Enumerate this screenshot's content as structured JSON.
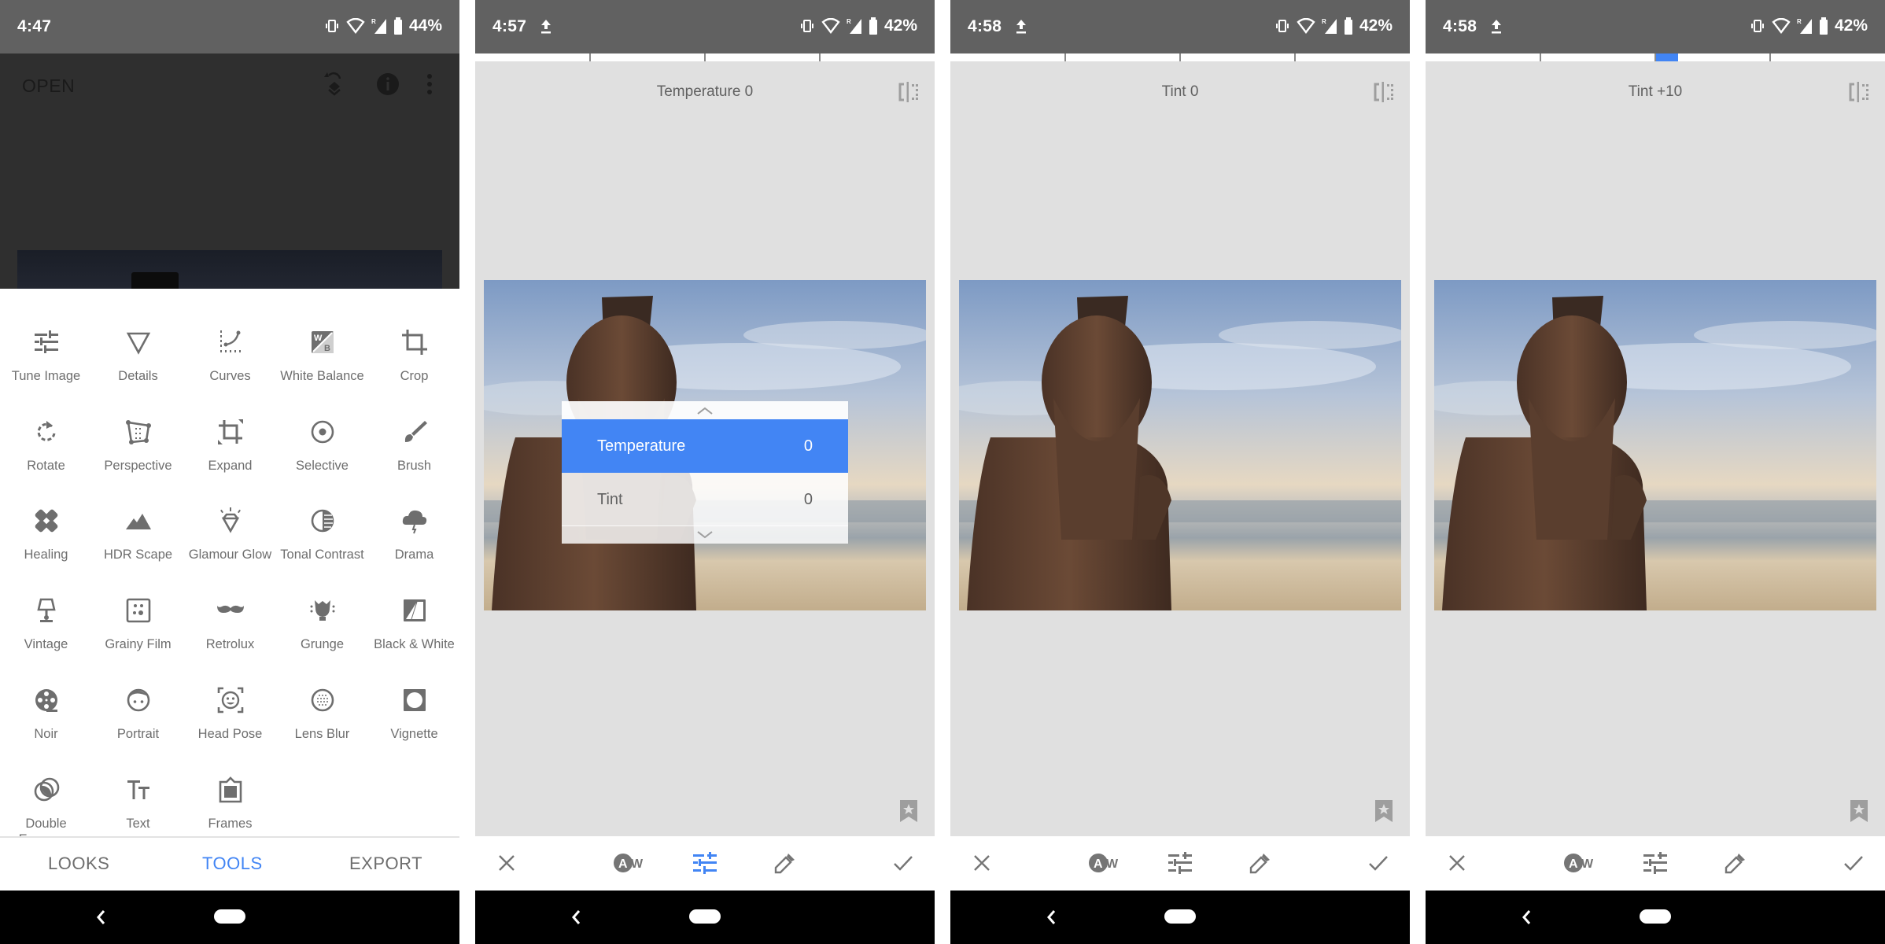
{
  "colors": {
    "accent": "#4285f4",
    "status_bar": "#616161",
    "editor_bg": "#e0e0e0",
    "icon_gray": "#6e6e6e"
  },
  "panels": [
    {
      "status": {
        "time": "4:47",
        "battery": "44%",
        "upload_icon": false
      },
      "header": {
        "open_label": "OPEN",
        "icons": [
          "undo-stack-icon",
          "info-icon",
          "more-vert-icon"
        ]
      },
      "tools": [
        {
          "label": "Tune Image",
          "icon": "tune-icon"
        },
        {
          "label": "Details",
          "icon": "details-triangle-icon"
        },
        {
          "label": "Curves",
          "icon": "curves-icon"
        },
        {
          "label": "White Balance",
          "icon": "white-balance-icon"
        },
        {
          "label": "Crop",
          "icon": "crop-icon"
        },
        {
          "label": "Rotate",
          "icon": "rotate-icon"
        },
        {
          "label": "Perspective",
          "icon": "perspective-icon"
        },
        {
          "label": "Expand",
          "icon": "expand-icon"
        },
        {
          "label": "Selective",
          "icon": "selective-icon"
        },
        {
          "label": "Brush",
          "icon": "brush-icon"
        },
        {
          "label": "Healing",
          "icon": "healing-icon"
        },
        {
          "label": "HDR Scape",
          "icon": "hdr-scape-icon"
        },
        {
          "label": "Glamour Glow",
          "icon": "glamour-glow-icon"
        },
        {
          "label": "Tonal Contrast",
          "icon": "tonal-contrast-icon"
        },
        {
          "label": "Drama",
          "icon": "drama-icon"
        },
        {
          "label": "Vintage",
          "icon": "vintage-lamp-icon"
        },
        {
          "label": "Grainy Film",
          "icon": "grainy-film-icon"
        },
        {
          "label": "Retrolux",
          "icon": "retrolux-mustache-icon"
        },
        {
          "label": "Grunge",
          "icon": "grunge-icon"
        },
        {
          "label": "Black & White",
          "icon": "black-white-icon"
        },
        {
          "label": "Noir",
          "icon": "noir-reel-icon"
        },
        {
          "label": "Portrait",
          "icon": "portrait-face-icon"
        },
        {
          "label": "Head Pose",
          "icon": "head-pose-icon"
        },
        {
          "label": "Lens Blur",
          "icon": "lens-blur-icon"
        },
        {
          "label": "Vignette",
          "icon": "vignette-icon"
        },
        {
          "label": "Double Exposure",
          "icon": "double-exposure-icon"
        },
        {
          "label": "Text",
          "icon": "text-icon"
        },
        {
          "label": "Frames",
          "icon": "frames-icon"
        }
      ],
      "tabs": [
        {
          "label": "LOOKS",
          "active": false
        },
        {
          "label": "TOOLS",
          "active": true
        },
        {
          "label": "EXPORT",
          "active": false
        }
      ]
    },
    {
      "status": {
        "time": "4:57",
        "battery": "42%",
        "upload_icon": true
      },
      "adjustment_title": "Temperature 0",
      "slider": {
        "min": -100,
        "max": 100,
        "value": 0
      },
      "menu_open": true,
      "menu": [
        {
          "label": "Temperature",
          "value": "0",
          "selected": true
        },
        {
          "label": "Tint",
          "value": "0",
          "selected": false
        }
      ],
      "toolbar_active": "adjust"
    },
    {
      "status": {
        "time": "4:58",
        "battery": "42%",
        "upload_icon": true
      },
      "adjustment_title": "Tint 0",
      "slider": {
        "min": -100,
        "max": 100,
        "value": 0
      },
      "menu_open": false,
      "toolbar_active": null
    },
    {
      "status": {
        "time": "4:58",
        "battery": "42%",
        "upload_icon": true
      },
      "adjustment_title": "Tint +10",
      "slider": {
        "min": -100,
        "max": 100,
        "value": 10
      },
      "menu_open": false,
      "toolbar_active": null
    }
  ],
  "toolbar_buttons": [
    "cancel",
    "auto-white-balance",
    "adjust",
    "eyedropper",
    "apply"
  ]
}
